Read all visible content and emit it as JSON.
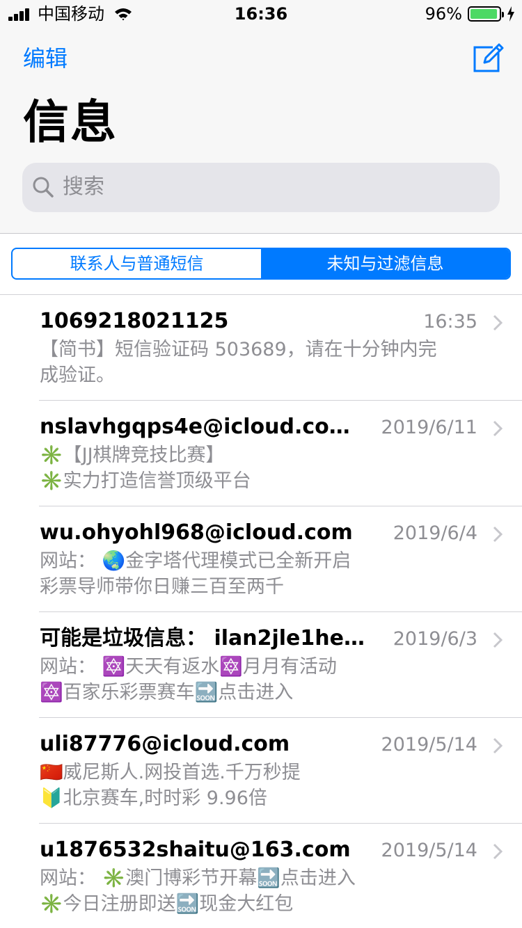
{
  "status_bar": {
    "carrier": "中国移动",
    "time": "16:36",
    "battery_percent": "96%",
    "battery_level": 0.96,
    "battery_color": "#4cd964"
  },
  "nav": {
    "edit_label": "编辑",
    "compose_icon": "compose-icon",
    "title": "信息"
  },
  "search": {
    "placeholder": "搜索",
    "icon": "search-icon"
  },
  "segments": [
    {
      "label": "联系人与普通短信",
      "selected": false
    },
    {
      "label": "未知与过滤信息",
      "selected": true
    }
  ],
  "accent_color": "#007aff",
  "messages": [
    {
      "sender": "1069218021125",
      "date": "16:35",
      "lines": [
        "【简书】短信验证码 503689，请在十分钟内完",
        "成验证。"
      ]
    },
    {
      "sender": "nslavhgqps4e@icloud.com...",
      "date": "2019/6/11",
      "lines": [
        "✳️【JJ棋牌竞技比赛】",
        "✳️实力打造信誉顶级平台"
      ]
    },
    {
      "sender": "wu.ohyohl968@icloud.com",
      "date": "2019/6/4",
      "lines": [
        "网站： 🌏金字塔代理模式已全新开启",
        "彩票导师带你日赚三百至两千"
      ]
    },
    {
      "sender": "可能是垃圾信息： ilan2jle1hev...",
      "date": "2019/6/3",
      "lines": [
        "网站： 🔯天天有返水🔯月月有活动",
        "🔯百家乐彩票赛车🔜点击进入"
      ]
    },
    {
      "sender": "uli87776@icloud.com",
      "date": "2019/5/14",
      "lines": [
        "🇨🇳威尼斯人.网投首选.千万秒提",
        "🔰北京赛车,时时彩 9.96倍"
      ]
    },
    {
      "sender": "u1876532shaitu@163.com",
      "date": "2019/5/14",
      "lines": [
        "网站： ✳️澳门博彩节开幕🔜点击进入",
        "✳️今日注册即送🔜现金大红包"
      ]
    }
  ]
}
